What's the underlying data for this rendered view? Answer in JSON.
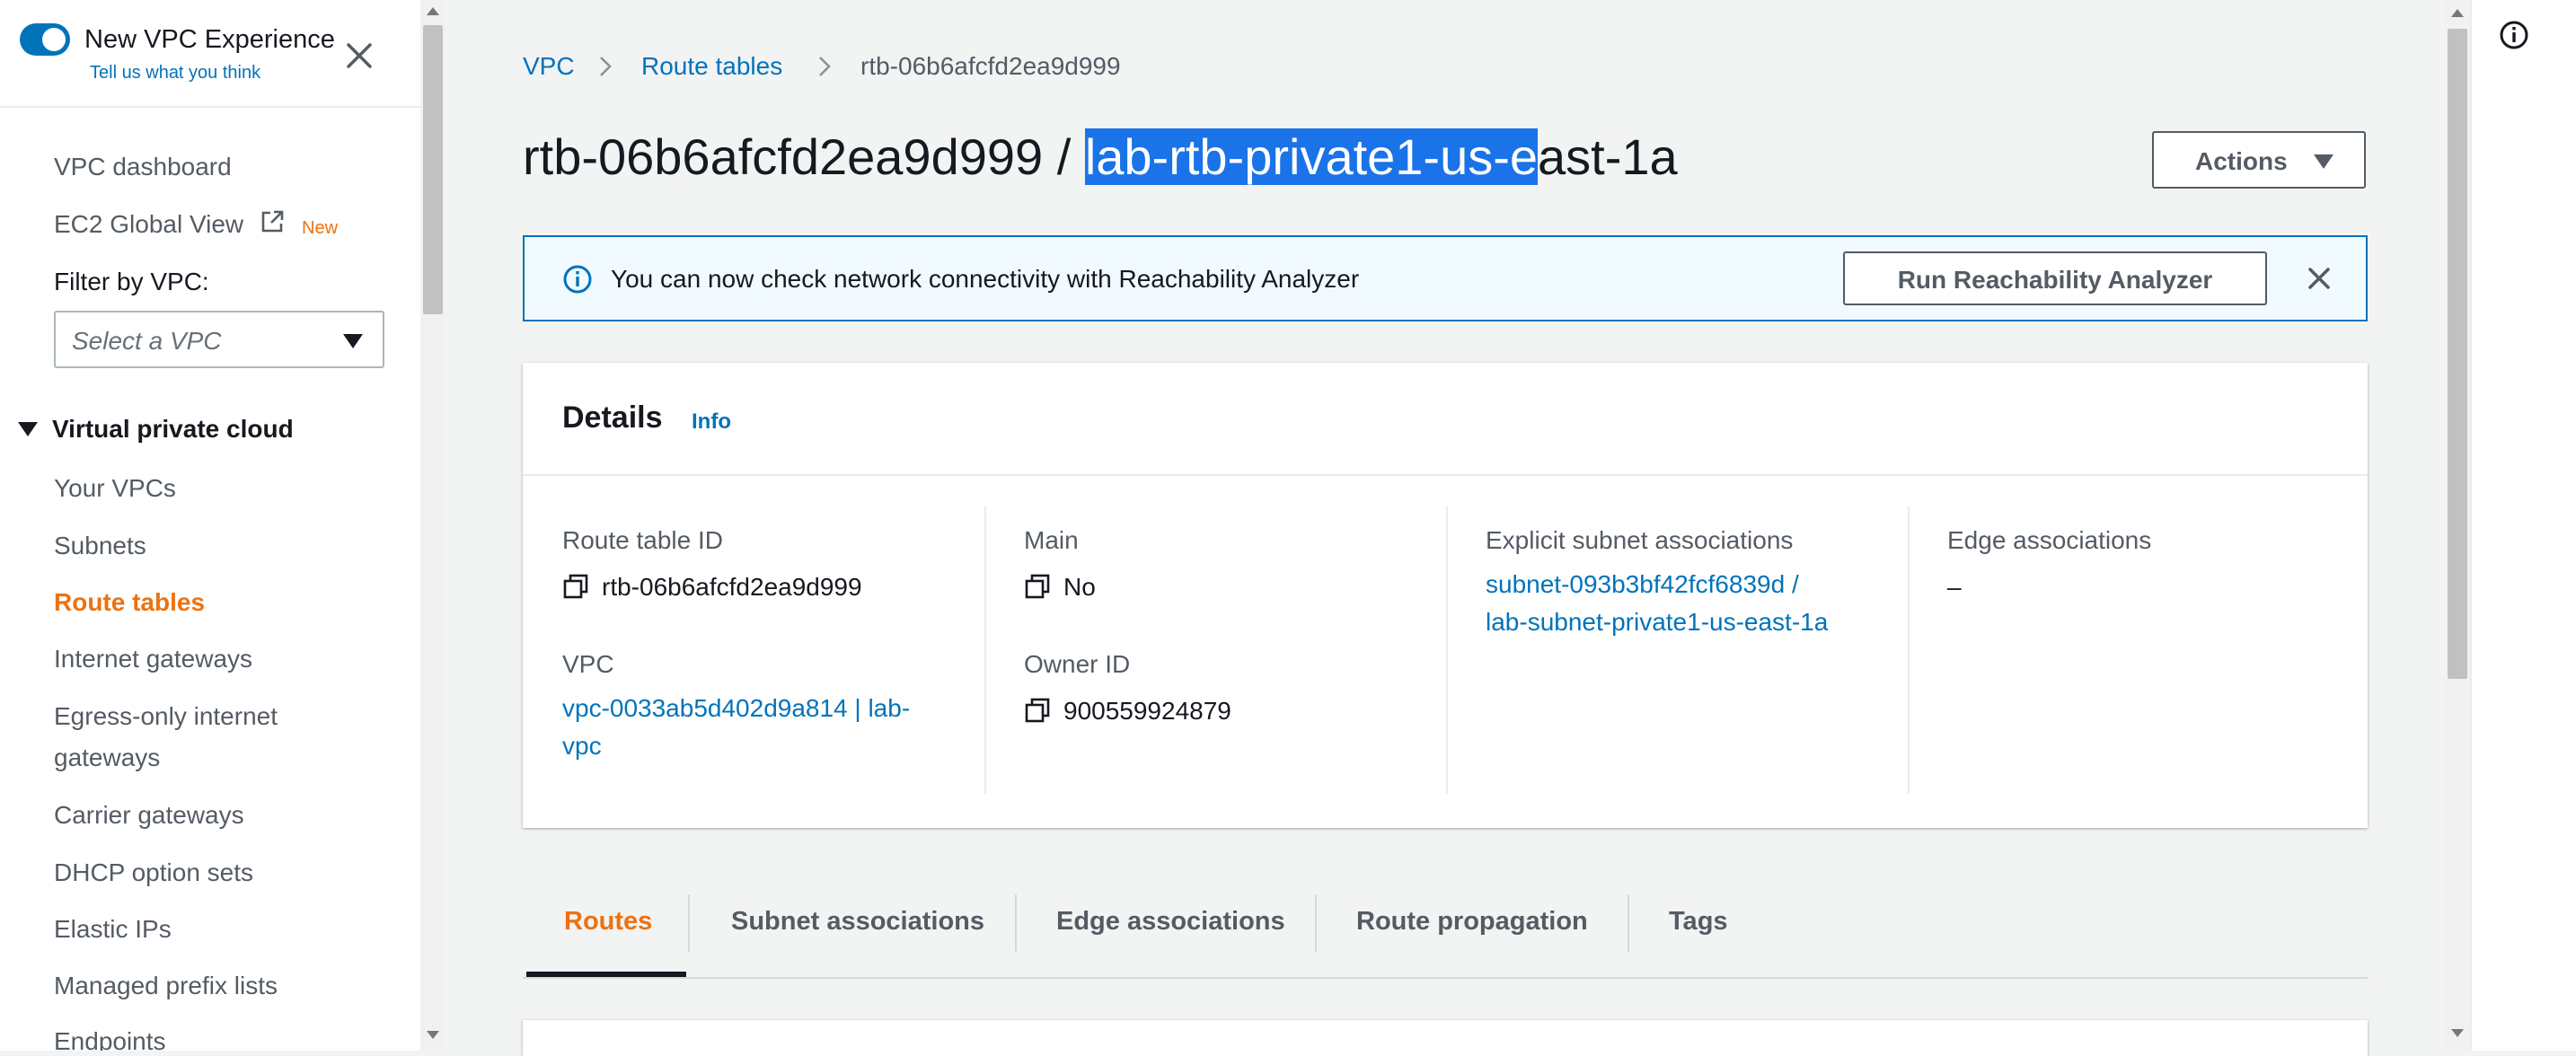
{
  "sidebar": {
    "toggle_on": true,
    "title": "New VPC Experience",
    "feedback_link": "Tell us what you think",
    "items_top": [
      {
        "label": "VPC dashboard"
      },
      {
        "label": "EC2 Global View",
        "badge": "New"
      }
    ],
    "filter_label": "Filter by VPC:",
    "filter_placeholder": "Select a VPC",
    "section": "Virtual private cloud",
    "section_items": [
      {
        "label": "Your VPCs"
      },
      {
        "label": "Subnets"
      },
      {
        "label": "Route tables",
        "active": true
      },
      {
        "label": "Internet gateways"
      },
      {
        "label": "Egress-only internet",
        "label2": "gateways"
      },
      {
        "label": "Carrier gateways"
      },
      {
        "label": "DHCP option sets"
      },
      {
        "label": "Elastic IPs"
      },
      {
        "label": "Managed prefix lists"
      },
      {
        "label": "Endpoints"
      }
    ]
  },
  "breadcrumb": [
    "VPC",
    "Route tables",
    "rtb-06b6afcfd2ea9d999"
  ],
  "page": {
    "title_prefix": "rtb-06b6afcfd2ea9d999 / ",
    "title_selected": "lab-rtb-private1-us-e",
    "title_suffix": "ast-1a",
    "actions_label": "Actions"
  },
  "banner": {
    "message": "You can now check network connectivity with Reachability Analyzer",
    "button": "Run Reachability Analyzer"
  },
  "details": {
    "heading": "Details",
    "info": "Info",
    "route_table_id_label": "Route table ID",
    "route_table_id": "rtb-06b6afcfd2ea9d999",
    "vpc_label": "VPC",
    "vpc_line1": "vpc-0033ab5d402d9a814 | lab-",
    "vpc_line2": "vpc",
    "main_label": "Main",
    "main_value": "No",
    "owner_label": "Owner ID",
    "owner_value": "900559924879",
    "explicit_label": "Explicit subnet associations",
    "explicit_line1": "subnet-093b3bf42fcf6839d /",
    "explicit_line2": "lab-subnet-private1-us-east-1a",
    "edge_label": "Edge associations",
    "edge_value": "–"
  },
  "tabs": [
    "Routes",
    "Subnet associations",
    "Edge associations",
    "Route propagation",
    "Tags"
  ],
  "colors": {
    "accent": "#0073bb",
    "active_nav": "#ec7211",
    "selection": "#1a73e8"
  }
}
